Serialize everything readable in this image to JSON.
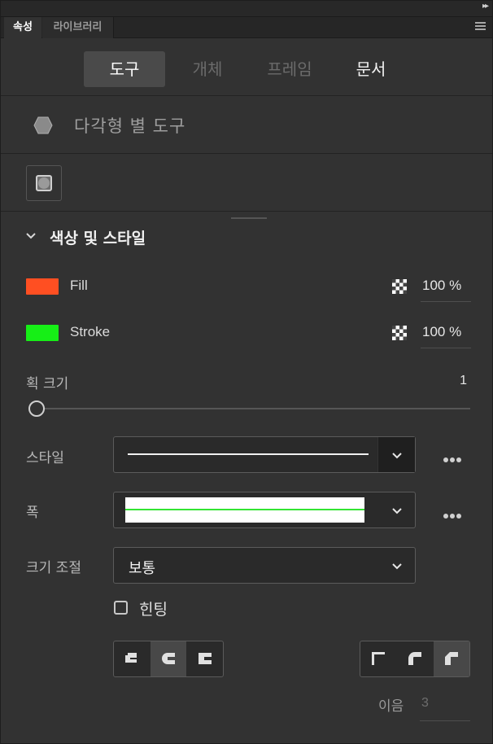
{
  "panel": {
    "collapse_glyph": "▸▸",
    "tabs": [
      {
        "label": "속성",
        "active": true
      },
      {
        "label": "라이브러리",
        "active": false
      }
    ],
    "menu_icon": "hamburger-menu-icon"
  },
  "modes": {
    "tool": "도구",
    "object": "개체",
    "frame": "프레임",
    "document": "문서",
    "selected": "도구",
    "disabled": [
      "개체",
      "프레임"
    ]
  },
  "tool": {
    "icon": "polygon-icon",
    "label": "다각형 별 도구"
  },
  "section": {
    "title": "색상 및 스타일",
    "expanded": true
  },
  "fill": {
    "label": "Fill",
    "color": "#ff4f22",
    "alpha": "100 %"
  },
  "stroke": {
    "label": "Stroke",
    "color": "#16ef16",
    "alpha": "100 %"
  },
  "stroke_size": {
    "label": "획 크기",
    "value": "1",
    "slider_fraction": 0.0
  },
  "style_field": {
    "label": "스타일",
    "preview": "solid-line"
  },
  "width_field": {
    "label": "폭",
    "preview_line_color": "#33e533"
  },
  "scale_field": {
    "label": "크기 조절",
    "value": "보통"
  },
  "hinting": {
    "label": "힌팅",
    "checked": false
  },
  "cap": {
    "options": [
      "cap-none-icon",
      "cap-round-icon",
      "cap-square-icon"
    ],
    "selected": "cap-round-icon"
  },
  "join": {
    "options": [
      "join-miter-icon",
      "join-round-icon",
      "join-bevel-icon"
    ],
    "selected": "join-bevel-icon"
  },
  "miter": {
    "label": "이음",
    "value": "3"
  }
}
